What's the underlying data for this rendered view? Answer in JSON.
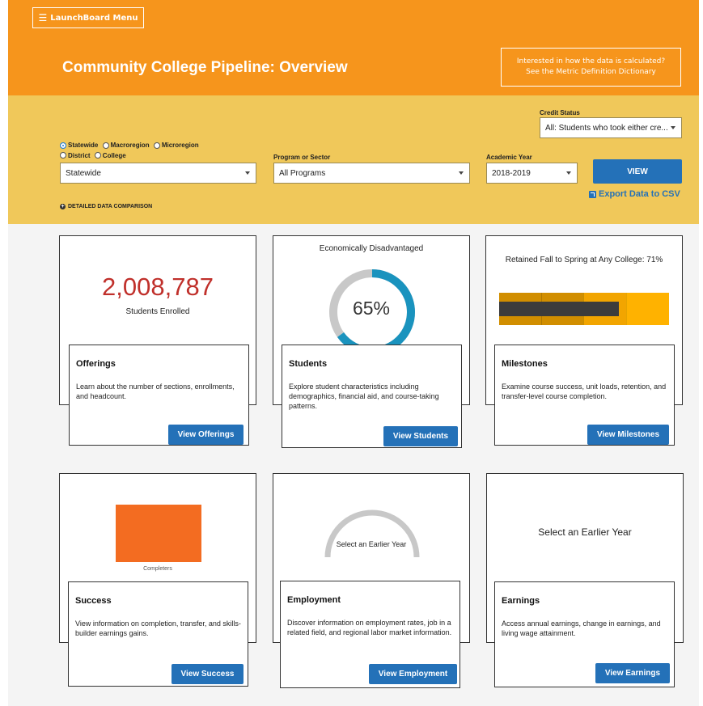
{
  "header": {
    "menu_label": "LaunchBoard Menu",
    "title": "Community College Pipeline: Overview",
    "metric_link_line1": "Interested in how the data is calculated?",
    "metric_link_line2": "See the Metric Definition Dictionary"
  },
  "filters": {
    "credit_status_label": "Credit Status",
    "credit_status_value": "All: Students who took either cre...",
    "geo_options": [
      "Statewide",
      "Macroregion",
      "Microregion",
      "District",
      "College"
    ],
    "geo_selected": "Statewide",
    "geo_value": "Statewide",
    "program_label": "Program or Sector",
    "program_value": "All Programs",
    "year_label": "Academic Year",
    "year_value": "2018-2019",
    "view_label": "VIEW",
    "export_label": "Export Data to CSV",
    "detailed_label": "DETAILED DATA COMPARISON"
  },
  "cards": {
    "offerings": {
      "metric_value": "2,008,787",
      "metric_label": "Students Enrolled",
      "title": "Offerings",
      "description": "Learn about the number of sections, enrollments, and headcount.",
      "button": "View Offerings"
    },
    "students": {
      "chart_title": "Economically Disadvantaged",
      "percent_label": "65%",
      "percent_value": 65,
      "title": "Students",
      "description": "Explore student characteristics including demographics, financial aid, and course-taking patterns.",
      "button": "View Students"
    },
    "milestones": {
      "chart_title": "Retained Fall to Spring at Any College: 71%",
      "retained_value": 71,
      "title": "Milestones",
      "description": "Examine course success, unit loads, retention, and transfer-level course completion.",
      "button": "View Milestones"
    },
    "success": {
      "chart_label": "Completers",
      "title": "Success",
      "description": "View information on completion, transfer, and skills-builder earnings gains.",
      "button": "View Success"
    },
    "employment": {
      "placeholder": "Select an Earlier Year",
      "title": "Employment",
      "description": "Discover information on employment rates, job in a related field, and regional labor market information.",
      "button": "View Employment"
    },
    "earnings": {
      "placeholder": "Select an Earlier Year",
      "title": "Earnings",
      "description": "Access annual earnings, change in earnings, and living wage attainment.",
      "button": "View Earnings"
    }
  },
  "colors": {
    "header_orange": "#f6951c",
    "filter_gold": "#f0c85a",
    "button_blue": "#2471b8",
    "metric_red": "#c0302b",
    "donut_teal": "#1a93be",
    "success_orange": "#f36c21"
  }
}
